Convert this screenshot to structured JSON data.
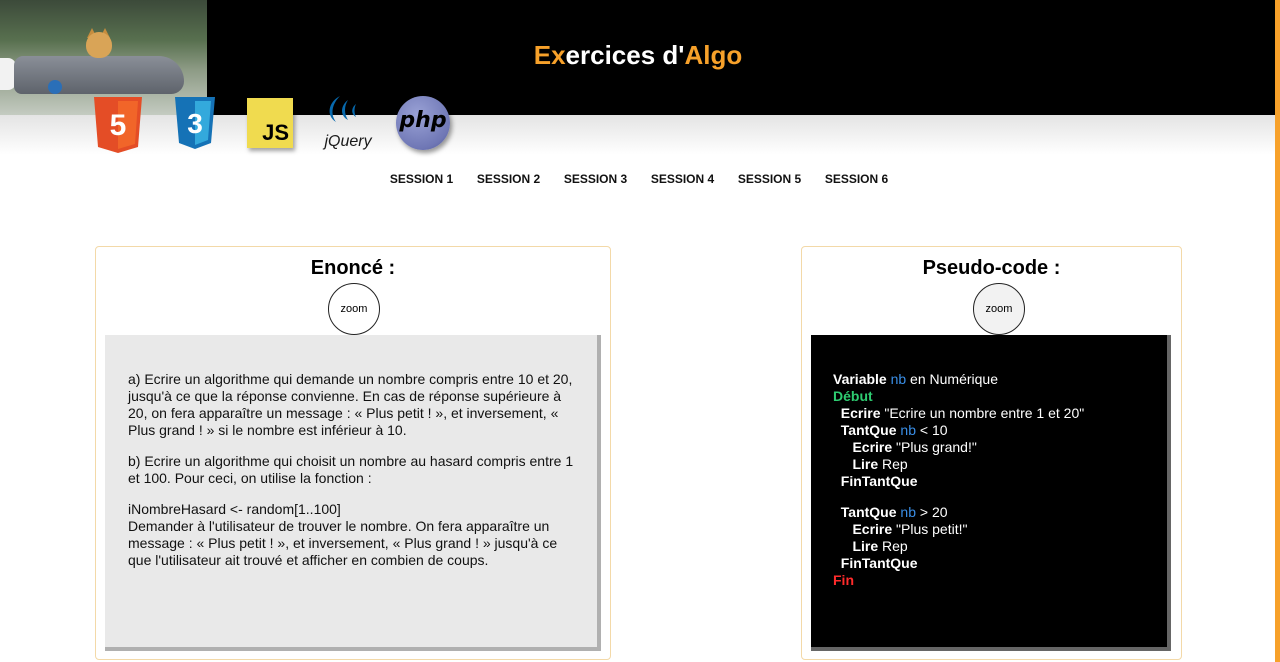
{
  "header": {
    "title_accent_1": "Ex",
    "title_part_1": "ercices d'",
    "title_accent_2": "Algo"
  },
  "logos": {
    "html5_label": "5",
    "css3_label": "3",
    "js_label": "JS",
    "jquery_label": "jQuery",
    "php_label": "php"
  },
  "nav": {
    "items": [
      "SESSION 1",
      "SESSION 2",
      "SESSION 3",
      "SESSION 4",
      "SESSION 5",
      "SESSION 6"
    ]
  },
  "enonce": {
    "title": "Enoncé :",
    "zoom_label": "zoom",
    "paragraphs": [
      "a) Ecrire un algorithme qui demande un nombre compris entre 10 et 20, jusqu'à ce que la réponse convienne. En cas de réponse supérieure à 20, on fera apparaître un message : « Plus petit ! », et inversement, « Plus grand ! » si le nombre est inférieur à 10.",
      "b) Ecrire un algorithme qui choisit un nombre au hasard compris entre 1 et 100. Pour ceci, on utilise la fonction :"
    ],
    "function_line": "iNombreHasard <- random[1..100]",
    "instruction": "Demander à l'utilisateur de trouver le nombre. On fera apparaître un message : « Plus petit ! », et inversement, « Plus grand ! » jusqu'à ce que l'utilisateur ait trouvé et afficher en combien de coups."
  },
  "pseudo": {
    "title": "Pseudo-code :",
    "zoom_label": "zoom",
    "l1_kw": "Variable",
    "l1_var": "nb",
    "l1_rest": " en Numérique",
    "l2_kw": "Début",
    "l3_indent": "  ",
    "l3_kw": "Ecrire",
    "l3_rest": " \"Ecrire un nombre entre 1 et 20\"",
    "l4_indent": "  ",
    "l4_kw": "TantQue",
    "l4_var": "nb",
    "l4_rest": " < 10",
    "l5_indent": "     ",
    "l5_kw": "Ecrire",
    "l5_rest": " \"Plus grand!\"",
    "l6_indent": "     ",
    "l6_kw": "Lire",
    "l6_rest": " Rep",
    "l7_indent": "  ",
    "l7_kw": "FinTantQue",
    "l8_indent": "  ",
    "l8_kw": "TantQue",
    "l8_var": "nb",
    "l8_rest": " > 20",
    "l9_indent": "     ",
    "l9_kw": "Ecrire",
    "l9_rest": " \"Plus petit!\"",
    "l10_indent": "     ",
    "l10_kw": "Lire",
    "l10_rest": " Rep",
    "l11_indent": "  ",
    "l11_kw": "FinTantQue",
    "l12_kw": "Fin"
  },
  "colors": {
    "accent": "#f7a12a",
    "code_green": "#2ecc71",
    "code_red": "#ff2b2b",
    "code_blue": "#3a8ee6"
  }
}
